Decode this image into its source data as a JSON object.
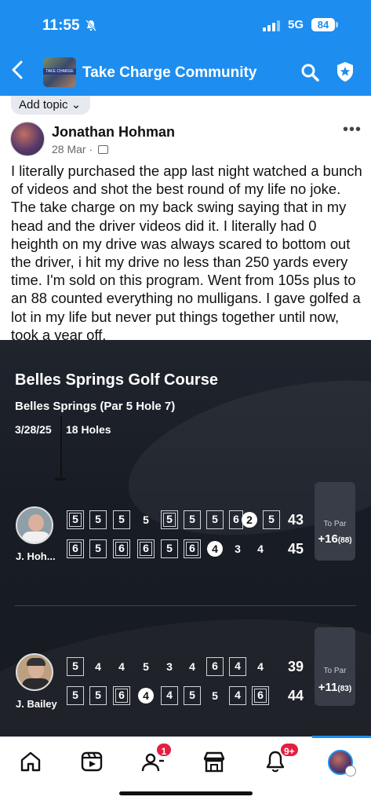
{
  "status_bar": {
    "time": "11:55",
    "network": "5G",
    "battery": "84"
  },
  "header": {
    "title": "Take Charge Community",
    "group_thumb_text": "TAKE CHARGE"
  },
  "topic": {
    "label": "Add topic ⌄"
  },
  "post": {
    "author": "Jonathan Hohman",
    "date": "28 Mar · ",
    "text": "I literally purchased the app last night watched a bunch of videos and shot the best round of my life no joke. The take charge on my back swing saying that in my head and the driver videos did it. I literally had 0 heighth on my drive was always scared to bottom out the driver, i hit my drive no less than 250 yards every time. I'm sold on this program. Went from 105s plus to an 88 counted everything no mulligans. I gave golfed a lot in my life but never put things together until now, took a year off."
  },
  "scorecard": {
    "course": "Belles Springs Golf Course",
    "subtitle": "Belles Springs (Par 5 Hole 7)",
    "date": "3/28/25",
    "holes": "18 Holes",
    "players": [
      {
        "name": "J. Hoh...",
        "to_par_label": "To Par",
        "to_par": "+16",
        "total": "(88)",
        "front": {
          "scores": [
            "5",
            "5",
            "5",
            "5",
            "5",
            "5",
            "5",
            "6",
            "2",
            "5"
          ],
          "total": "43"
        },
        "back": {
          "scores": [
            "6",
            "5",
            "6",
            "6",
            "5",
            "6",
            "4",
            "3",
            "4"
          ],
          "total": "45"
        }
      },
      {
        "name": "J. Bailey",
        "to_par_label": "To Par",
        "to_par": "+11",
        "total": "(83)",
        "front": {
          "scores": [
            "5",
            "4",
            "4",
            "5",
            "3",
            "4",
            "6",
            "4",
            "4"
          ],
          "total": "39"
        },
        "back": {
          "scores": [
            "5",
            "5",
            "6",
            "4",
            "4",
            "5",
            "5",
            "4",
            "6"
          ],
          "total": "44"
        }
      }
    ]
  },
  "nav": {
    "items": [
      "home-tab",
      "video-tab",
      "friends-tab",
      "marketplace-tab",
      "notifications-tab",
      "profile-tab"
    ],
    "friends_badge": "1",
    "notifications_badge": "9+"
  },
  "colors": {
    "brand_blue": "#1d8ef0",
    "card_bg": "#181c24",
    "badge_red": "#e41e3f"
  }
}
